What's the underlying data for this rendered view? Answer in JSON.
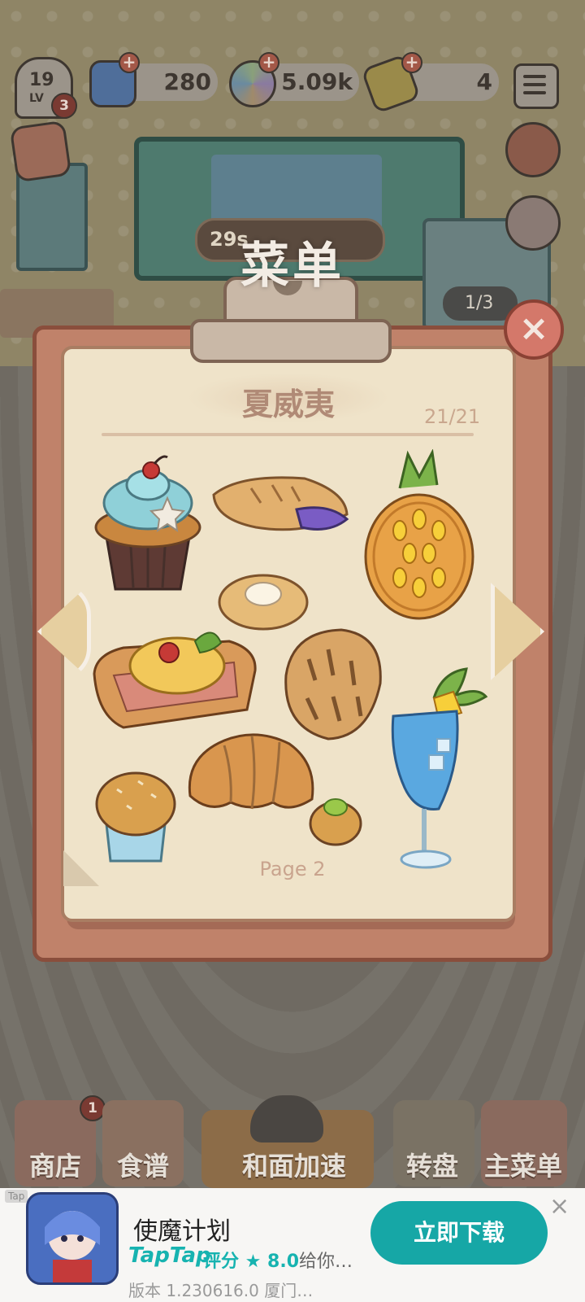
{
  "hud": {
    "level": "19",
    "level_label": "LV",
    "level_badge": "3",
    "gems": "280",
    "coins": "5.09k",
    "tickets": "4"
  },
  "scene": {
    "timer": "29s",
    "page_counter": "1/3"
  },
  "dialog": {
    "title": "菜单",
    "section_title": "夏威夷",
    "progress": "21/21",
    "page_label": "Page 2",
    "close_label": "×",
    "items": [
      "cupcake-icon",
      "pastry-roll-icon",
      "pineapple-bread-icon",
      "cream-bun-icon",
      "toast-egg-icon",
      "focaccia-icon",
      "croissant-icon",
      "muffin-icon",
      "choux-puff-icon",
      "blue-cocktail-icon"
    ]
  },
  "bottom_nav": {
    "shop": "商店",
    "shop_badge": "1",
    "recipes": "食谱",
    "knead_speed": "和面加速",
    "wheel": "转盘",
    "main_menu": "主菜单"
  },
  "ad": {
    "tag": "Tap",
    "title": "使魔计划",
    "brand": "TapTap",
    "rating_text": "评分 ★ 8.0",
    "description": "给你…",
    "version": "版本 1.230616.0  厦门…",
    "cta": "立即下载",
    "close": "×"
  },
  "colors": {
    "board": "#c0826a",
    "paper": "#efe3c9",
    "close_button": "#d4786a",
    "ad_cta": "#16a7a6"
  }
}
